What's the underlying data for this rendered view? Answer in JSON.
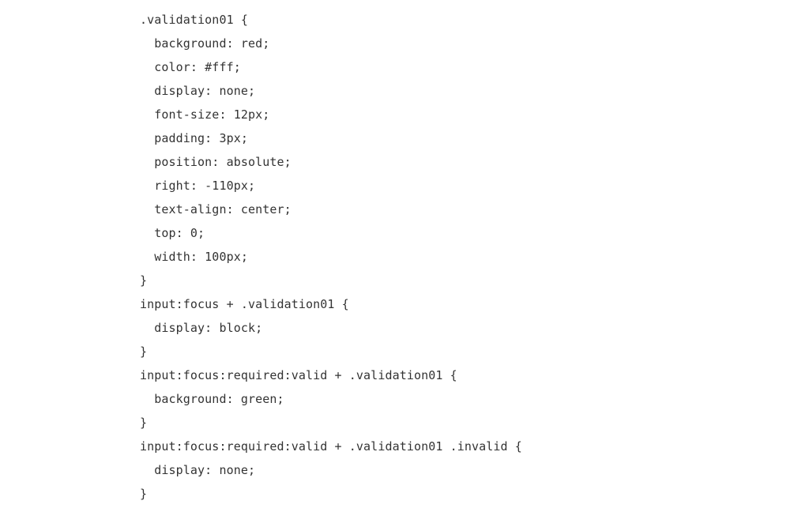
{
  "code": {
    "lines": [
      ".validation01 {",
      "  background: red;",
      "  color: #fff;",
      "  display: none;",
      "  font-size: 12px;",
      "  padding: 3px;",
      "  position: absolute;",
      "  right: -110px;",
      "  text-align: center;",
      "  top: 0;",
      "  width: 100px;",
      "}",
      "input:focus + .validation01 {",
      "  display: block;",
      "}",
      "input:focus:required:valid + .validation01 {",
      "  background: green;",
      "}",
      "input:focus:required:valid + .validation01 .invalid {",
      "  display: none;",
      "}"
    ]
  },
  "colors": {
    "text": "#333333",
    "background": "#ffffff"
  }
}
